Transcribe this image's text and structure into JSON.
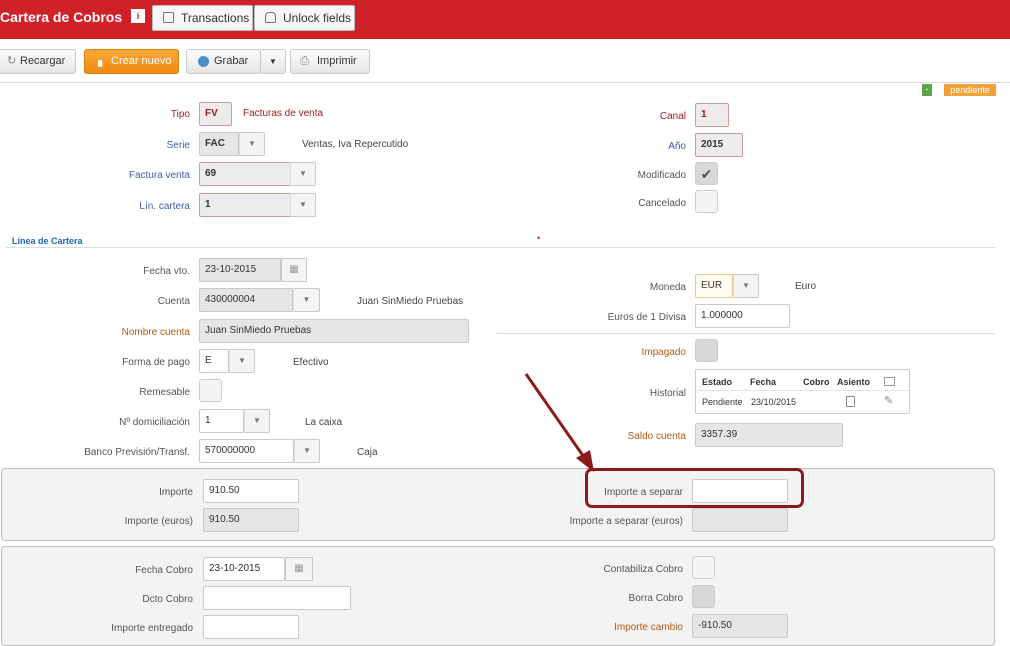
{
  "app": {
    "title": "Cartera de Cobros",
    "info_badge": "i",
    "tab_transactions": "Transactions",
    "tab_unlock": "Unlock fields"
  },
  "toolbar": {
    "reload": "Recargar",
    "create": "Crear nuevo",
    "save": "Grabar",
    "print": "Imprimir"
  },
  "status": {
    "indicator": "-",
    "badge": "pendiente"
  },
  "header": {
    "tipo": {
      "label": "Tipo",
      "value": "FV",
      "desc": "Facturas de venta"
    },
    "serie": {
      "label": "Serie",
      "value": "FAC",
      "desc": "Ventas, Iva Repercutido"
    },
    "factura": {
      "label": "Factura venta",
      "value": "69"
    },
    "linea": {
      "label": "Lín. cartera",
      "value": "1"
    },
    "canal": {
      "label": "Canal",
      "value": "1"
    },
    "anio": {
      "label": "Año",
      "value": "2015"
    },
    "modificado": {
      "label": "Modificado",
      "check": "✔"
    },
    "cancelado": {
      "label": "Cancelado"
    }
  },
  "section": {
    "title": "Línea de Cartera",
    "dot": "•"
  },
  "linea": {
    "fecha_vto": {
      "label": "Fecha vto.",
      "value": "23-10-2015"
    },
    "cuenta": {
      "label": "Cuenta",
      "value": "430000004",
      "desc": "Juan SinMiedo Pruebas"
    },
    "nombre": {
      "label": "Nombre cuenta",
      "value": "Juan SinMiedo Pruebas"
    },
    "forma_pago": {
      "label": "Forma de pago",
      "value": "E",
      "desc": "Efectivo"
    },
    "remesable": {
      "label": "Remesable"
    },
    "domiciliacion": {
      "label": "Nº domiciliación",
      "value": "1",
      "desc": "La caixa"
    },
    "banco": {
      "label": "Banco Previsión/Transf.",
      "value": "570000000",
      "desc": "Caja"
    },
    "moneda": {
      "label": "Moneda",
      "value": "EUR",
      "desc": "Euro"
    },
    "euros_divisa": {
      "label": "Euros de 1 Divisa",
      "value": "1.000000"
    },
    "impagado": {
      "label": "Impagado"
    },
    "historial": {
      "label": "Historial",
      "col_estado": "Estado",
      "col_fecha": "Fecha",
      "col_cobro": "Cobro",
      "col_asiento": "Asiento",
      "row_estado": "Pendiente",
      "row_fecha": "23/10/2015"
    },
    "saldo": {
      "label": "Saldo cuenta",
      "value": "3357.39"
    }
  },
  "importe": {
    "importe": {
      "label": "Importe",
      "value": "910.50"
    },
    "importe_euros": {
      "label": "Importe (euros)",
      "value": "910.50"
    },
    "separar": {
      "label": "Importe a separar",
      "value": ""
    },
    "separar_euros": {
      "label": "Importe a separar (euros)",
      "value": ""
    }
  },
  "cobro": {
    "fecha": {
      "label": "Fecha Cobro",
      "value": "23-10-2015"
    },
    "dcto": {
      "label": "Dcto Cobro",
      "value": ""
    },
    "entregado": {
      "label": "Importe entregado",
      "value": ""
    },
    "contabiliza": {
      "label": "Contabiliza Cobro"
    },
    "borra": {
      "label": "Borra Cobro"
    },
    "cambio": {
      "label": "Importe cambio",
      "value": "-910.50"
    }
  }
}
